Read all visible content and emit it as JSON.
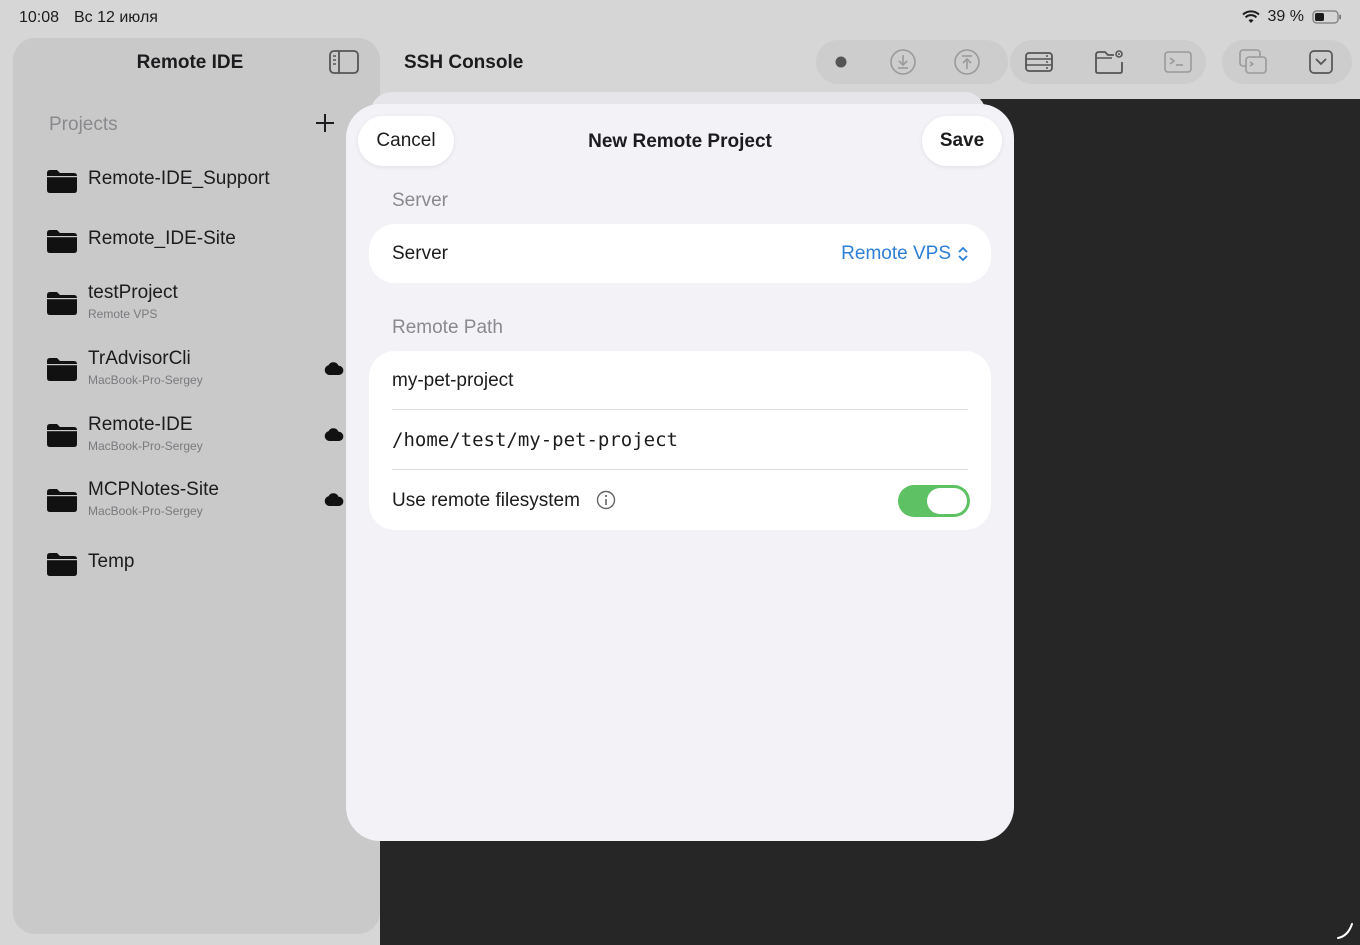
{
  "status_bar": {
    "time": "10:08",
    "date": "Вс 12 июля",
    "battery": "39 %"
  },
  "sidebar": {
    "title": "Remote IDE",
    "projects_header": "Projects",
    "projects": [
      {
        "name": "Remote-IDE_Support",
        "subtitle": "",
        "cloud": false
      },
      {
        "name": "Remote_IDE-Site",
        "subtitle": "",
        "cloud": false
      },
      {
        "name": "testProject",
        "subtitle": "Remote VPS",
        "cloud": false
      },
      {
        "name": "TrAdvisorCli",
        "subtitle": "MacBook-Pro-Sergey",
        "cloud": true
      },
      {
        "name": "Remote-IDE",
        "subtitle": "MacBook-Pro-Sergey",
        "cloud": true
      },
      {
        "name": "MCPNotes-Site",
        "subtitle": "MacBook-Pro-Sergey",
        "cloud": true
      },
      {
        "name": "Temp",
        "subtitle": "",
        "cloud": false
      }
    ]
  },
  "toolbar": {
    "title": "SSH Console",
    "icons": [
      "record-dot-icon",
      "download-icon",
      "upload-icon",
      "server-icon",
      "folder-settings-icon",
      "terminal-icon",
      "windows-icon",
      "dropdown-icon"
    ]
  },
  "modal": {
    "title": "New Remote Project",
    "cancel_label": "Cancel",
    "save_label": "Save",
    "server_section": "Server",
    "server_label": "Server",
    "server_value": "Remote VPS",
    "path_section": "Remote Path",
    "project_name": "my-pet-project",
    "remote_path": "/home/test/my-pet-project",
    "filesystem_label": "Use remote filesystem",
    "filesystem_enabled": true
  },
  "colors": {
    "accent": "#2e7fd8",
    "toggle_on": "#5ec163",
    "console_bg": "#262626"
  }
}
